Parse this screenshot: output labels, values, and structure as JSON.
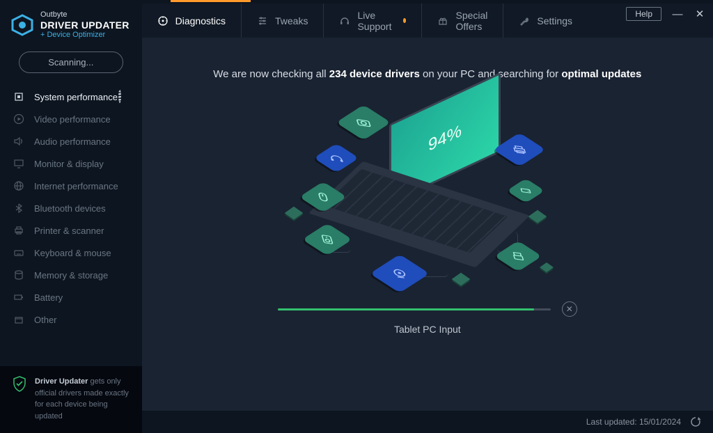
{
  "window": {
    "help_label": "Help"
  },
  "brand": {
    "company": "Outbyte",
    "product": "DRIVER UPDATER",
    "tagline": "+ Device Optimizer"
  },
  "scan_button_label": "Scanning...",
  "sidebar": {
    "items": [
      {
        "label": "System performance",
        "active": true
      },
      {
        "label": "Video performance"
      },
      {
        "label": "Audio performance"
      },
      {
        "label": "Monitor & display"
      },
      {
        "label": "Internet performance"
      },
      {
        "label": "Bluetooth devices"
      },
      {
        "label": "Printer & scanner"
      },
      {
        "label": "Keyboard & mouse"
      },
      {
        "label": "Memory & storage"
      },
      {
        "label": "Battery"
      },
      {
        "label": "Other"
      }
    ],
    "footer": {
      "strong": "Driver Updater",
      "rest": " gets only official drivers made exactly for each device being updated"
    }
  },
  "tabs": [
    {
      "label": "Diagnostics",
      "active": true
    },
    {
      "label": "Tweaks"
    },
    {
      "label": "Live Support",
      "indicator": true
    },
    {
      "label": "Special Offers"
    },
    {
      "label": "Settings"
    }
  ],
  "headline": {
    "pre": "We are now checking all ",
    "count": "234 device drivers",
    "mid": " on your PC and searching for ",
    "tail": "optimal updates"
  },
  "scan": {
    "percent_text": "94%",
    "progress_fill_pct": 94,
    "current_item": "Tablet PC Input"
  },
  "status_bar": {
    "last_updated_label": "Last updated: ",
    "last_updated_value": "15/01/2024"
  }
}
